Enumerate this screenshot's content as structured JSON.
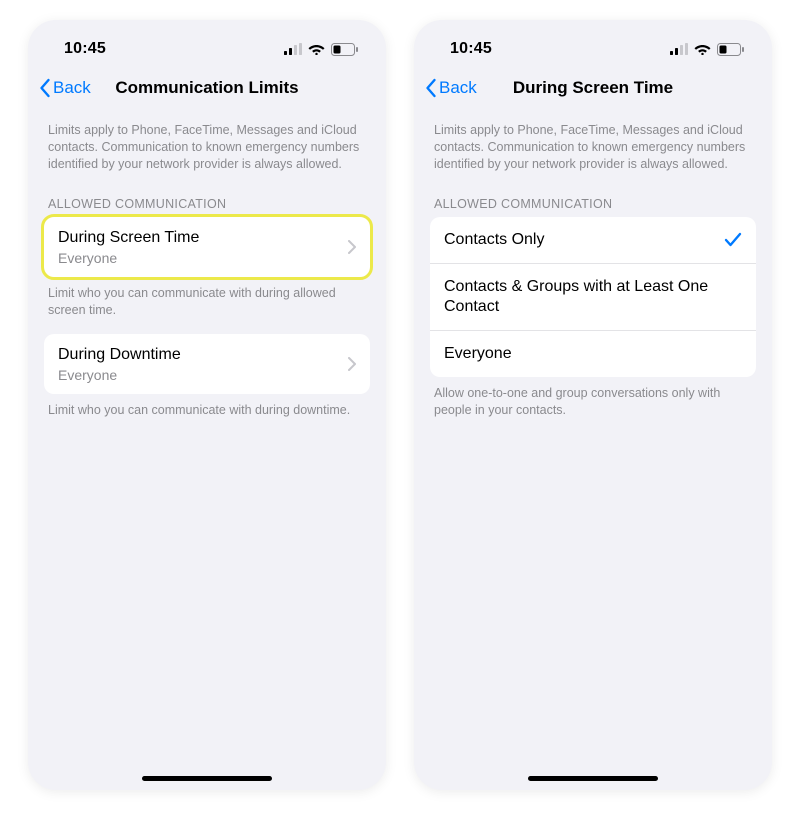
{
  "status": {
    "time": "10:45"
  },
  "left": {
    "nav": {
      "back": "Back",
      "title": "Communication Limits"
    },
    "intro": "Limits apply to Phone, FaceTime, Messages and iCloud contacts. Communication to known emergency numbers identified by your network provider is always allowed.",
    "section_header": "ALLOWED COMMUNICATION",
    "rows": {
      "r0": {
        "title": "During Screen Time",
        "sub": "Everyone"
      },
      "r1": {
        "title": "During Downtime",
        "sub": "Everyone"
      }
    },
    "foot0": "Limit who you can communicate with during allowed screen time.",
    "foot1": "Limit who you can communicate with during downtime."
  },
  "right": {
    "nav": {
      "back": "Back",
      "title": "During Screen Time"
    },
    "intro": "Limits apply to Phone, FaceTime, Messages and iCloud contacts. Communication to known emergency numbers identified by your network provider is always allowed.",
    "section_header": "ALLOWED COMMUNICATION",
    "options": {
      "o0": "Contacts Only",
      "o1": "Contacts & Groups with at Least One Contact",
      "o2": "Everyone"
    },
    "selected": "o0",
    "foot": "Allow one-to-one and group conversations only with people in your contacts."
  }
}
